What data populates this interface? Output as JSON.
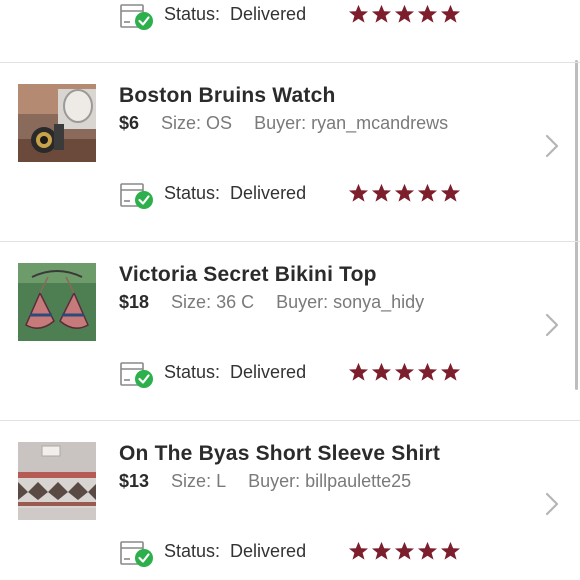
{
  "colors": {
    "star": "#7d1e2c",
    "check": "#2db04b",
    "divider": "#e2e2e2"
  },
  "status_label": "Status:",
  "items": [
    {
      "title": "",
      "price": "",
      "size": "",
      "buyer": "",
      "status": "Delivered",
      "rating": 5
    },
    {
      "title": "Boston Bruins Watch",
      "price": "$6",
      "size": "Size: OS",
      "buyer": "Buyer: ryan_mcandrews",
      "status": "Delivered",
      "rating": 5
    },
    {
      "title": "Victoria Secret Bikini Top",
      "price": "$18",
      "size": "Size: 36 C",
      "buyer": "Buyer: sonya_hidy",
      "status": "Delivered",
      "rating": 5
    },
    {
      "title": "On The Byas Short Sleeve Shirt",
      "price": "$13",
      "size": "Size: L",
      "buyer": "Buyer: billpaulette25",
      "status": "Delivered",
      "rating": 5
    }
  ],
  "icons": {
    "status": "package-delivered-icon",
    "star": "star-icon",
    "chevron": "chevron-right-icon"
  }
}
